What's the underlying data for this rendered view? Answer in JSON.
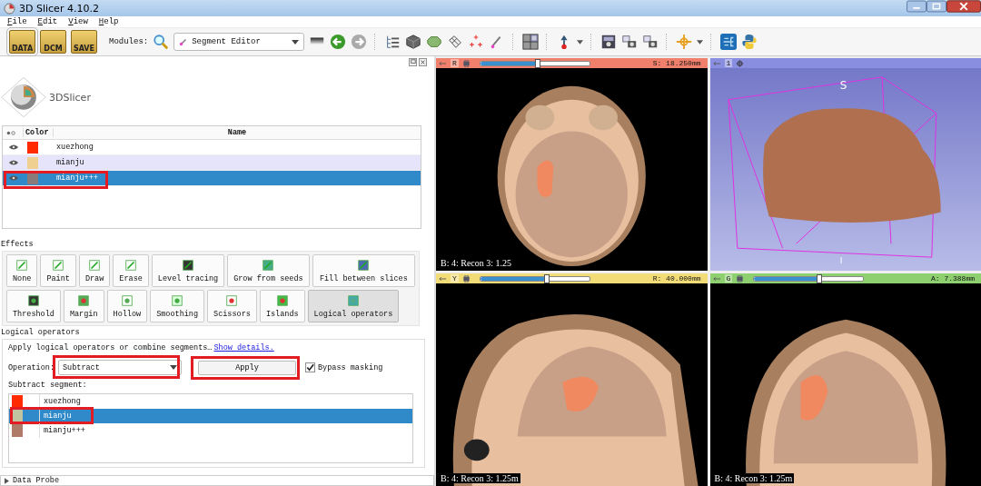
{
  "window": {
    "title": "3D Slicer 4.10.2"
  },
  "menu": [
    "File",
    "Edit",
    "View",
    "Help"
  ],
  "toolbar": {
    "load_buttons": [
      "DATA",
      "DCM",
      "SAVE"
    ],
    "modules_label": "Modules:",
    "module": "Segment Editor"
  },
  "logo": {
    "text": "3DSlicer"
  },
  "segments": {
    "columns": [
      "Color",
      "Name"
    ],
    "rows": [
      {
        "name": "xuezhong",
        "color": "#ff2a00",
        "selected": false,
        "highlighted": false
      },
      {
        "name": "mianju",
        "color": "#f0d090",
        "selected": false,
        "highlighted": false
      },
      {
        "name": "mianju+++",
        "color": "#8a7b7b",
        "selected": true,
        "highlighted": true
      }
    ]
  },
  "effects": {
    "title": "Effects",
    "buttons": [
      {
        "label": "None",
        "selected": false
      },
      {
        "label": "Paint",
        "selected": false
      },
      {
        "label": "Draw",
        "selected": false
      },
      {
        "label": "Erase",
        "selected": false
      },
      {
        "label": "Level tracing",
        "selected": false
      },
      {
        "label": "Grow from seeds",
        "selected": false
      },
      {
        "label": "Fill between slices",
        "selected": false
      },
      {
        "label": "Threshold",
        "selected": false
      },
      {
        "label": "Margin",
        "selected": false
      },
      {
        "label": "Hollow",
        "selected": false
      },
      {
        "label": "Smoothing",
        "selected": false
      },
      {
        "label": "Scissors",
        "selected": false
      },
      {
        "label": "Islands",
        "selected": false
      },
      {
        "label": "Logical operators",
        "selected": true
      }
    ]
  },
  "logical": {
    "title": "Logical operators",
    "description": "Apply logical operators or combine segments…",
    "link": "Show details.",
    "operation_label": "Operation:",
    "operation": {
      "value": "Subtract",
      "highlighted": true
    },
    "apply": {
      "label": "Apply",
      "highlighted": true
    },
    "bypass_masking": {
      "label": "Bypass masking",
      "checked": true
    },
    "segment_label": "Subtract segment:",
    "segments": [
      {
        "name": "xuezhong",
        "color": "#ff2a00",
        "selected": false,
        "highlighted": false
      },
      {
        "name": "mianju",
        "color": "#c0c4a0",
        "selected": true,
        "highlighted": true
      },
      {
        "name": "mianju+++",
        "color": "#b07a68",
        "selected": false,
        "highlighted": false
      }
    ]
  },
  "data_probe": "Data Probe",
  "views": [
    {
      "kind": "axial",
      "letter": "R",
      "color": "#f0806c",
      "offset": "S: 18.250mm",
      "level": 0.53,
      "annotation": "B: 4: Recon 3: 1.25"
    },
    {
      "kind": "volume",
      "letter": "1",
      "color": "#8a8ee0",
      "top_label": "S",
      "bottom_label": "I"
    },
    {
      "kind": "sagittal",
      "letter": "Y",
      "color": "#f2dc78",
      "offset": "R: 40.000mm",
      "level": 0.61,
      "annotation": "B: 4: Recon 3: 1.25m"
    },
    {
      "kind": "coronal",
      "letter": "G",
      "color": "#8ed070",
      "offset": "A: 7.388mm",
      "level": 0.6,
      "annotation": "B: 4: Recon 3: 1.25m"
    }
  ]
}
